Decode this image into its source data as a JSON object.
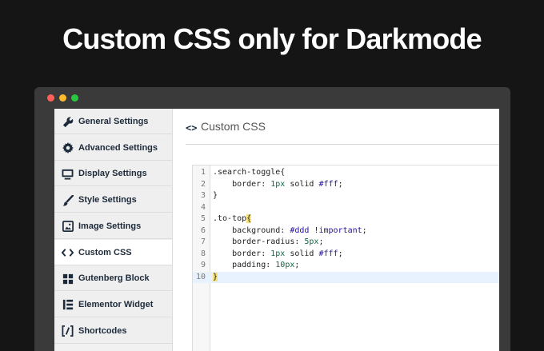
{
  "headline": "Custom CSS only for Darkmode",
  "sidebar": {
    "items": [
      {
        "label": "General Settings",
        "icon": "wrench-icon"
      },
      {
        "label": "Advanced Settings",
        "icon": "gear-icon"
      },
      {
        "label": "Display Settings",
        "icon": "monitor-icon"
      },
      {
        "label": "Style Settings",
        "icon": "brush-icon"
      },
      {
        "label": "Image Settings",
        "icon": "image-icon"
      },
      {
        "label": "Custom CSS",
        "icon": "code-icon",
        "active": true
      },
      {
        "label": "Gutenberg Block",
        "icon": "blocks-icon"
      },
      {
        "label": "Elementor Widget",
        "icon": "elementor-icon"
      },
      {
        "label": "Shortcodes",
        "icon": "shortcode-icon"
      }
    ]
  },
  "main": {
    "title_icon": "<>",
    "title": "Custom CSS"
  },
  "editor": {
    "lines": [
      {
        "num": "1",
        "segments": [
          {
            "t": ".search-toggle{",
            "c": ""
          }
        ]
      },
      {
        "num": "2",
        "segments": [
          {
            "t": "    border: ",
            "c": ""
          },
          {
            "t": "1px",
            "c": "tok-num"
          },
          {
            "t": " solid ",
            "c": ""
          },
          {
            "t": "#fff",
            "c": "tok-atom"
          },
          {
            "t": ";",
            "c": ""
          }
        ]
      },
      {
        "num": "3",
        "segments": [
          {
            "t": "}",
            "c": ""
          }
        ]
      },
      {
        "num": "4",
        "segments": []
      },
      {
        "num": "5",
        "segments": [
          {
            "t": ".to-top",
            "c": ""
          },
          {
            "t": "{",
            "c": "tok-hl"
          }
        ]
      },
      {
        "num": "6",
        "segments": [
          {
            "t": "    background: ",
            "c": ""
          },
          {
            "t": "#ddd",
            "c": "tok-atom"
          },
          {
            "t": " ",
            "c": ""
          },
          {
            "t": "!important",
            "c": "tok-imp"
          },
          {
            "t": ";",
            "c": ""
          }
        ]
      },
      {
        "num": "7",
        "segments": [
          {
            "t": "    border-radius: ",
            "c": ""
          },
          {
            "t": "5px",
            "c": "tok-num"
          },
          {
            "t": ";",
            "c": ""
          }
        ]
      },
      {
        "num": "8",
        "segments": [
          {
            "t": "    border: ",
            "c": ""
          },
          {
            "t": "1px",
            "c": "tok-num"
          },
          {
            "t": " solid ",
            "c": ""
          },
          {
            "t": "#fff",
            "c": "tok-atom"
          },
          {
            "t": ";",
            "c": ""
          }
        ]
      },
      {
        "num": "9",
        "segments": [
          {
            "t": "    padding: ",
            "c": ""
          },
          {
            "t": "10px",
            "c": "tok-num"
          },
          {
            "t": ";",
            "c": ""
          }
        ]
      },
      {
        "num": "10",
        "segments": [
          {
            "t": "}",
            "c": "tok-hl"
          }
        ],
        "active": true
      }
    ]
  },
  "colors": {
    "background": "#151515",
    "window": "#3a3a3a",
    "dot_red": "#ff5f57",
    "dot_yellow": "#febc2e",
    "dot_green": "#28c840",
    "sidebar": "#f1f1f1",
    "active_line": "#e8f2ff",
    "bracket_highlight": "#f6e27a"
  }
}
